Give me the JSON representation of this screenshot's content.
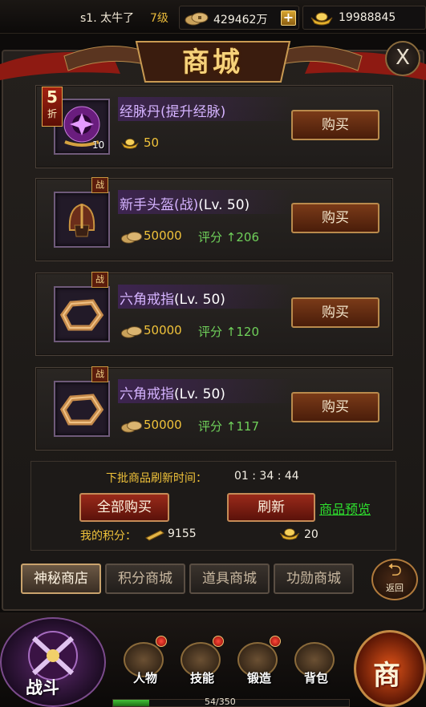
{
  "topbar": {
    "player_name": "s1. 太牛了",
    "level": "7级",
    "copper": "429462万",
    "gold": "19988845"
  },
  "window": {
    "title": "商城",
    "close_label": "X"
  },
  "items": [
    {
      "name": "经脉丹",
      "extra": "(提升经脉)",
      "quantity": "10",
      "discount": "5",
      "discount_unit": "折",
      "currency": "gold-ingot",
      "price": "50",
      "score_label": "",
      "score": "",
      "buy_label": "购买",
      "icon": "meridian-pill-icon"
    },
    {
      "name": "新手头盔(战)",
      "extra": "(Lv. 50)",
      "battle_tag": "战",
      "currency": "copper-coins",
      "price": "50000",
      "score_label": "评分",
      "score": "206",
      "buy_label": "购买",
      "icon": "helmet-icon"
    },
    {
      "name": "六角戒指",
      "extra": "(Lv. 50)",
      "battle_tag": "战",
      "currency": "copper-coins",
      "price": "50000",
      "score_label": "评分",
      "score": "120",
      "buy_label": "购买",
      "icon": "hexagon-ring-icon"
    },
    {
      "name": "六角戒指",
      "extra": "(Lv. 50)",
      "battle_tag": "战",
      "currency": "copper-coins",
      "price": "50000",
      "score_label": "评分",
      "score": "117",
      "buy_label": "购买",
      "icon": "hexagon-ring-icon"
    }
  ],
  "refresh": {
    "label": "下批商品刷新时间：",
    "time": "01 : 34 : 44",
    "buy_all_label": "全部购买",
    "refresh_label": "刷新",
    "preview_label": "商品预览",
    "my_points_label": "我的积分：",
    "my_points": "9155",
    "refresh_cost": "20"
  },
  "tabs": [
    {
      "label": "神秘商店",
      "active": true
    },
    {
      "label": "积分商城",
      "active": false
    },
    {
      "label": "道具商城",
      "active": false
    },
    {
      "label": "功勋商城",
      "active": false
    }
  ],
  "back_label": "返回",
  "hud": {
    "fight_label": "战斗",
    "buttons": [
      {
        "label": "人物",
        "icon": "character-icon"
      },
      {
        "label": "技能",
        "icon": "skill-scroll-icon"
      },
      {
        "label": "锻造",
        "icon": "forge-icon"
      },
      {
        "label": "背包",
        "icon": "bag-icon"
      }
    ],
    "shop_label": "商",
    "exp_text": "54/350",
    "exp_progress": 0.154
  },
  "colors": {
    "gold_text": "#f0c23a",
    "item_name": "#d5b3ff",
    "score_green": "#6fd05a",
    "preview_link": "#2ee02e"
  }
}
